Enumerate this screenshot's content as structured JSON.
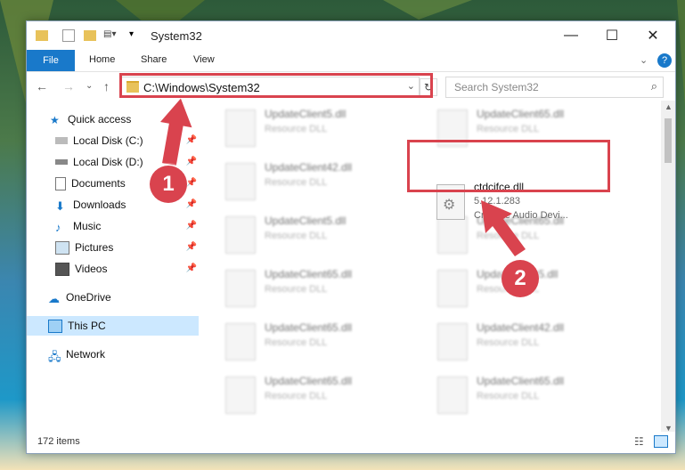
{
  "window": {
    "title": "System32"
  },
  "ribbon": {
    "file": "File",
    "home": "Home",
    "share": "Share",
    "view": "View"
  },
  "address": {
    "path": "C:\\Windows\\System32",
    "search_placeholder": "Search System32"
  },
  "sidebar": {
    "items": [
      {
        "label": "Quick access"
      },
      {
        "label": "Local Disk (C:)"
      },
      {
        "label": "Local Disk (D:)"
      },
      {
        "label": "Documents"
      },
      {
        "label": "Downloads"
      },
      {
        "label": "Music"
      },
      {
        "label": "Pictures"
      },
      {
        "label": "Videos"
      },
      {
        "label": "OneDrive"
      },
      {
        "label": "This PC"
      },
      {
        "label": "Network"
      }
    ]
  },
  "files": [
    {
      "name": "UpdateClient5.dll",
      "type": "Resource DLL"
    },
    {
      "name": "UpdateClient65.dll",
      "type": "Resource DLL"
    },
    {
      "name": "UpdateClient42.dll",
      "type": "Resource DLL"
    },
    {
      "name": "UpdateClient5.dll",
      "type": "Resource DLL"
    },
    {
      "name": "UpdateClient65.dll",
      "type": "Resource DLL"
    },
    {
      "name": "UpdateClient65.dll",
      "type": "Resource DLL"
    },
    {
      "name": "UpdateClient5.dll",
      "type": "Resource DLL"
    },
    {
      "name": "UpdateClient65.dll",
      "type": "Resource DLL"
    },
    {
      "name": "UpdateClient42.dll",
      "type": "Resource DLL"
    },
    {
      "name": "UpdateClient65.dll",
      "type": "Resource DLL"
    },
    {
      "name": "UpdateClient65.dll",
      "type": "Resource DLL"
    }
  ],
  "focus_file": {
    "name": "ctdcifce.dll",
    "version": "5.12.1.283",
    "description": "Creative Audio Devi..."
  },
  "status": {
    "count": "172 items"
  },
  "annotations": {
    "one": "1",
    "two": "2"
  },
  "colors": {
    "accent": "#1979ca",
    "highlight": "#d9434e",
    "selected": "#cce8ff"
  }
}
